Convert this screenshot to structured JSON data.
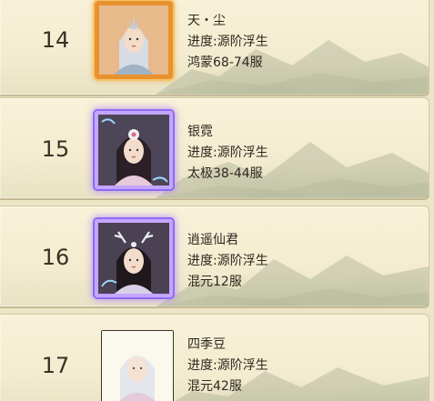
{
  "entries": [
    {
      "rank": "14",
      "name": "天・尘",
      "progress": "进度:源阶浮生",
      "server": "鸿蒙68-74服",
      "frame": "gold",
      "avatar_icon": "silver-hair-maiden-avatar-icon"
    },
    {
      "rank": "15",
      "name": "银霓",
      "progress": "进度:源阶浮生",
      "server": "太极38-44服",
      "frame": "purple",
      "avatar_icon": "dark-hair-maiden-avatar-icon"
    },
    {
      "rank": "16",
      "name": "逍遥仙君",
      "progress": "进度:源阶浮生",
      "server": "混元12服",
      "frame": "purple",
      "avatar_icon": "antler-headdress-maiden-avatar-icon"
    },
    {
      "rank": "17",
      "name": "四季豆",
      "progress": "进度:源阶浮生",
      "server": "混元42服",
      "frame": "plain",
      "avatar_icon": "white-hair-maiden-avatar-icon"
    }
  ],
  "colors": {
    "gold_frame": "#e9912c",
    "purple_frame": "#c4a5ff",
    "parchment": "#f3ecd0",
    "text": "#2e2820"
  }
}
